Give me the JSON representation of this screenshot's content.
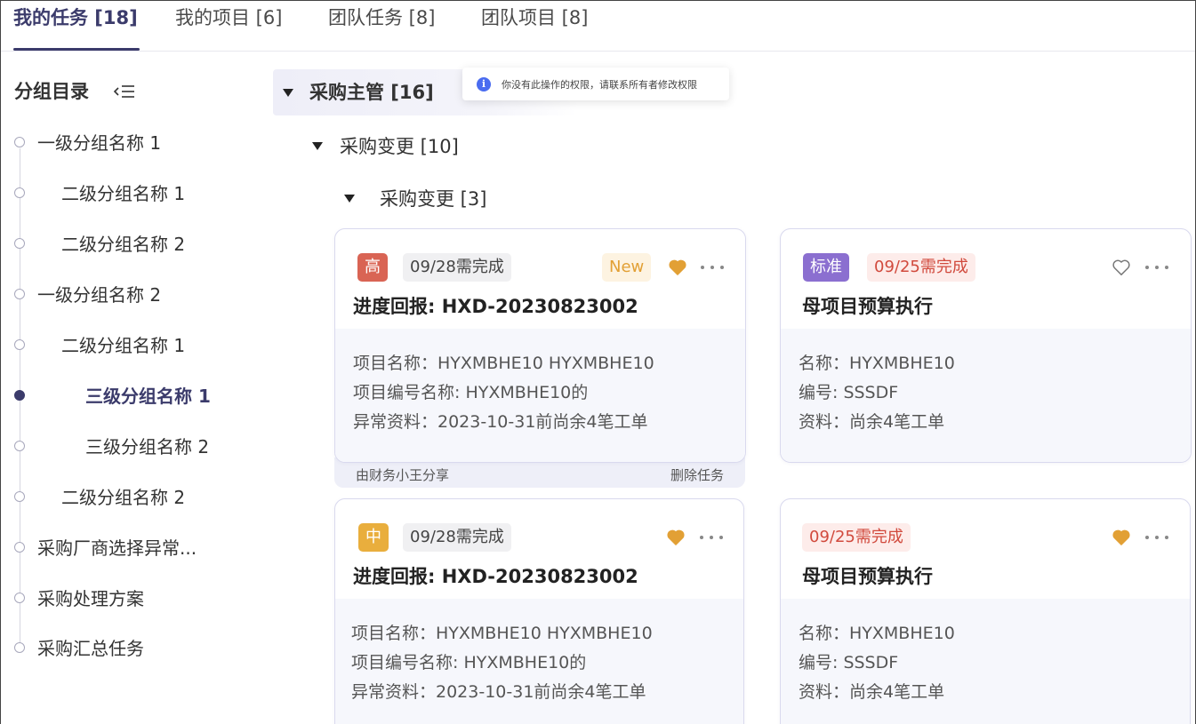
{
  "tabs": [
    {
      "label": "我的任务 [18]",
      "active": true
    },
    {
      "label": "我的项目 [6]",
      "active": false
    },
    {
      "label": "团队任务 [8]",
      "active": false
    },
    {
      "label": "团队项目 [8]",
      "active": false
    }
  ],
  "sidebar": {
    "title": "分组目录",
    "items": [
      {
        "label": "一级分组名称 1",
        "level": 1,
        "active": false
      },
      {
        "label": "二级分组名称 1",
        "level": 2,
        "active": false
      },
      {
        "label": "二级分组名称 2",
        "level": 2,
        "active": false
      },
      {
        "label": "一级分组名称 2",
        "level": 1,
        "active": false
      },
      {
        "label": "二级分组名称 1",
        "level": 2,
        "active": false
      },
      {
        "label": "三级分组名称 1",
        "level": 3,
        "active": true
      },
      {
        "label": "三级分组名称 2",
        "level": 3,
        "active": false
      },
      {
        "label": "二级分组名称 2",
        "level": 2,
        "active": false
      },
      {
        "label": "采购厂商选择异常...",
        "level": 1,
        "active": false
      },
      {
        "label": "采购处理方案",
        "level": 1,
        "active": false
      },
      {
        "label": "采购汇总任务",
        "level": 1,
        "active": false
      }
    ]
  },
  "groups": {
    "level1": "采购主管 [16]",
    "level2": "采购变更 [10]",
    "level3": "采购变更 [3]"
  },
  "toast": {
    "text": "你没有此操作的权限，请联系所有者修改权限"
  },
  "cards": [
    {
      "priority": "高",
      "due": "09/28需完成",
      "new_badge": "New",
      "favorited": true,
      "title": "进度回报: HXD-20230823002",
      "lines": [
        "项目名称：HYXMBHE10 HYXMBHE10",
        "项目编号名称: HYXMBHE10的",
        "异常资料：2023-10-31前尚余4笔工单"
      ],
      "footer_left": "由财务小王分享",
      "footer_right": "删除任务"
    },
    {
      "priority": "标准",
      "due": "09/25需完成",
      "favorited": false,
      "title": "母项目预算执行",
      "lines": [
        "名称：HYXMBHE10",
        "编号: SSSDF",
        "资料：尚余4笔工单"
      ]
    },
    {
      "priority": "中",
      "due": "09/28需完成",
      "favorited": true,
      "title": "进度回报: HXD-20230823002",
      "lines": [
        "项目名称：HYXMBHE10 HYXMBHE10",
        "项目编号名称: HYXMBHE10的",
        "异常资料：2023-10-31前尚余4笔工单"
      ]
    },
    {
      "due": "09/25需完成",
      "favorited": true,
      "title": "母项目预算执行",
      "lines": [
        "名称：HYXMBHE10",
        "编号: SSSDF",
        "资料：尚余4笔工单"
      ]
    }
  ],
  "colors": {
    "accent": "#3b3b6b",
    "heart_active": "#e2a035",
    "priority_high": "#d96454",
    "priority_mid": "#e9ae3d",
    "priority_std": "#8b6fd0",
    "due_red": "#d14a3d"
  }
}
